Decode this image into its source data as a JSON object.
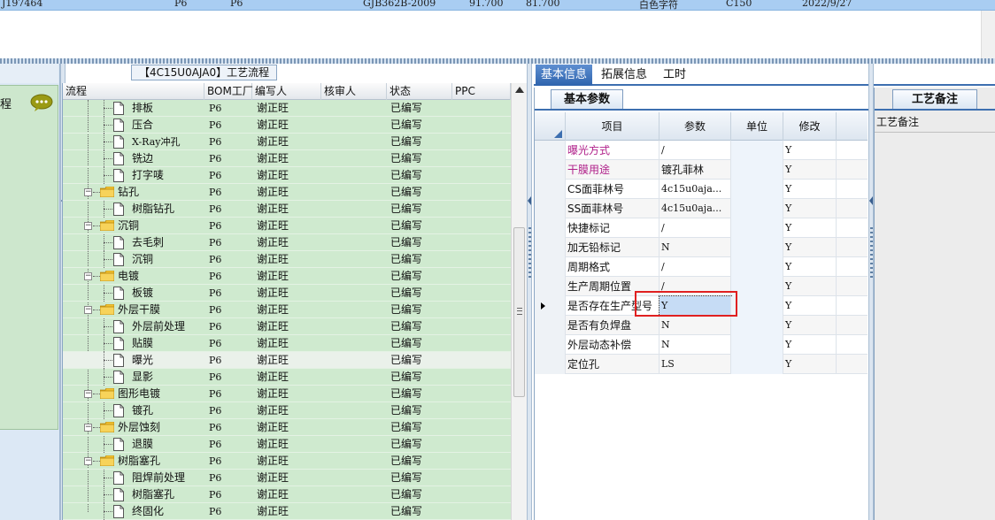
{
  "top_row": {
    "cells": [
      "J197464",
      "P6",
      "P6",
      "GJB362B-2009",
      "91.700",
      "81.700",
      "白色字符",
      "C150",
      "2022/9/27"
    ]
  },
  "left_panel": {
    "label": "程"
  },
  "middle": {
    "title": "【4C15U0AJA0】工艺流程",
    "columns": [
      "流程",
      "BOM工厂",
      "编写人",
      "核审人",
      "状态",
      "PPC"
    ],
    "rows": [
      {
        "name": "排板",
        "level": 2,
        "type": "item",
        "bom": "P6",
        "author": "谢正旺",
        "status": "已编写"
      },
      {
        "name": "压合",
        "level": 2,
        "type": "item",
        "bom": "P6",
        "author": "谢正旺",
        "status": "已编写"
      },
      {
        "name": "X-Ray冲孔",
        "level": 2,
        "type": "item",
        "bom": "P6",
        "author": "谢正旺",
        "status": "已编写"
      },
      {
        "name": "铣边",
        "level": 2,
        "type": "item",
        "bom": "P6",
        "author": "谢正旺",
        "status": "已编写"
      },
      {
        "name": "打字唛",
        "level": 2,
        "type": "item",
        "bom": "P6",
        "author": "谢正旺",
        "status": "已编写"
      },
      {
        "name": "钻孔",
        "level": 1,
        "type": "folder",
        "bom": "P6",
        "author": "谢正旺",
        "status": "已编写"
      },
      {
        "name": "树脂钻孔",
        "level": 2,
        "type": "item",
        "bom": "P6",
        "author": "谢正旺",
        "status": "已编写"
      },
      {
        "name": "沉铜",
        "level": 1,
        "type": "folder",
        "bom": "P6",
        "author": "谢正旺",
        "status": "已编写"
      },
      {
        "name": "去毛刺",
        "level": 2,
        "type": "item",
        "bom": "P6",
        "author": "谢正旺",
        "status": "已编写"
      },
      {
        "name": "沉铜",
        "level": 2,
        "type": "item",
        "bom": "P6",
        "author": "谢正旺",
        "status": "已编写"
      },
      {
        "name": "电镀",
        "level": 1,
        "type": "folder",
        "bom": "P6",
        "author": "谢正旺",
        "status": "已编写"
      },
      {
        "name": "板镀",
        "level": 2,
        "type": "item",
        "bom": "P6",
        "author": "谢正旺",
        "status": "已编写"
      },
      {
        "name": "外层干膜",
        "level": 1,
        "type": "folder",
        "bom": "P6",
        "author": "谢正旺",
        "status": "已编写"
      },
      {
        "name": "外层前处理",
        "level": 2,
        "type": "item",
        "bom": "P6",
        "author": "谢正旺",
        "status": "已编写"
      },
      {
        "name": "贴膜",
        "level": 2,
        "type": "item",
        "bom": "P6",
        "author": "谢正旺",
        "status": "已编写"
      },
      {
        "name": "曝光",
        "level": 2,
        "type": "item",
        "bom": "P6",
        "author": "谢正旺",
        "status": "已编写",
        "selected": true
      },
      {
        "name": "显影",
        "level": 2,
        "type": "item",
        "bom": "P6",
        "author": "谢正旺",
        "status": "已编写"
      },
      {
        "name": "图形电镀",
        "level": 1,
        "type": "folder",
        "bom": "P6",
        "author": "谢正旺",
        "status": "已编写"
      },
      {
        "name": "镀孔",
        "level": 2,
        "type": "item",
        "bom": "P6",
        "author": "谢正旺",
        "status": "已编写"
      },
      {
        "name": "外层蚀刻",
        "level": 1,
        "type": "folder",
        "bom": "P6",
        "author": "谢正旺",
        "status": "已编写"
      },
      {
        "name": "退膜",
        "level": 2,
        "type": "item",
        "bom": "P6",
        "author": "谢正旺",
        "status": "已编写"
      },
      {
        "name": "树脂塞孔",
        "level": 1,
        "type": "folder",
        "bom": "P6",
        "author": "谢正旺",
        "status": "已编写"
      },
      {
        "name": "阻焊前处理",
        "level": 2,
        "type": "item",
        "bom": "P6",
        "author": "谢正旺",
        "status": "已编写"
      },
      {
        "name": "树脂塞孔",
        "level": 2,
        "type": "item",
        "bom": "P6",
        "author": "谢正旺",
        "status": "已编写"
      },
      {
        "name": "终固化",
        "level": 2,
        "type": "item",
        "bom": "P6",
        "author": "谢正旺",
        "status": "已编写"
      }
    ]
  },
  "detail": {
    "tabs": [
      "基本信息",
      "拓展信息",
      "工时"
    ],
    "active_tab": 0,
    "sub_tab": "基本参数",
    "columns": [
      "项目",
      "参数",
      "单位",
      "修改"
    ],
    "rows": [
      {
        "item": "曝光方式",
        "param": "/",
        "unit": "",
        "modify": "Y",
        "color": "#b0208a"
      },
      {
        "item": "干膜用途",
        "param": "镀孔菲林",
        "unit": "",
        "modify": "Y",
        "color": "#b0208a"
      },
      {
        "item": "CS面菲林号",
        "param": "4c15u0aja...",
        "unit": "",
        "modify": "Y"
      },
      {
        "item": "SS面菲林号",
        "param": "4c15u0aja...",
        "unit": "",
        "modify": "Y"
      },
      {
        "item": "快捷标记",
        "param": "/",
        "unit": "",
        "modify": "Y"
      },
      {
        "item": "加无铅标记",
        "param": "N",
        "unit": "",
        "modify": "Y"
      },
      {
        "item": "周期格式",
        "param": "/",
        "unit": "",
        "modify": "Y"
      },
      {
        "item": "生产周期位置",
        "param": "/",
        "unit": "",
        "modify": "Y"
      },
      {
        "item": "是否存在生产型号",
        "param": "Y",
        "unit": "",
        "modify": "Y",
        "current": true
      },
      {
        "item": "是否有负焊盘",
        "param": "N",
        "unit": "",
        "modify": "Y"
      },
      {
        "item": "外层动态补偿",
        "param": "N",
        "unit": "",
        "modify": "Y"
      },
      {
        "item": "定位孔",
        "param": "LS",
        "unit": "",
        "modify": "Y"
      }
    ]
  },
  "notes": {
    "tab": "工艺备注",
    "label": "工艺备注"
  },
  "colors": {
    "tree_bg": "#cfeacf",
    "tab_active": "#2e63ad",
    "highlight": "#e02020"
  }
}
